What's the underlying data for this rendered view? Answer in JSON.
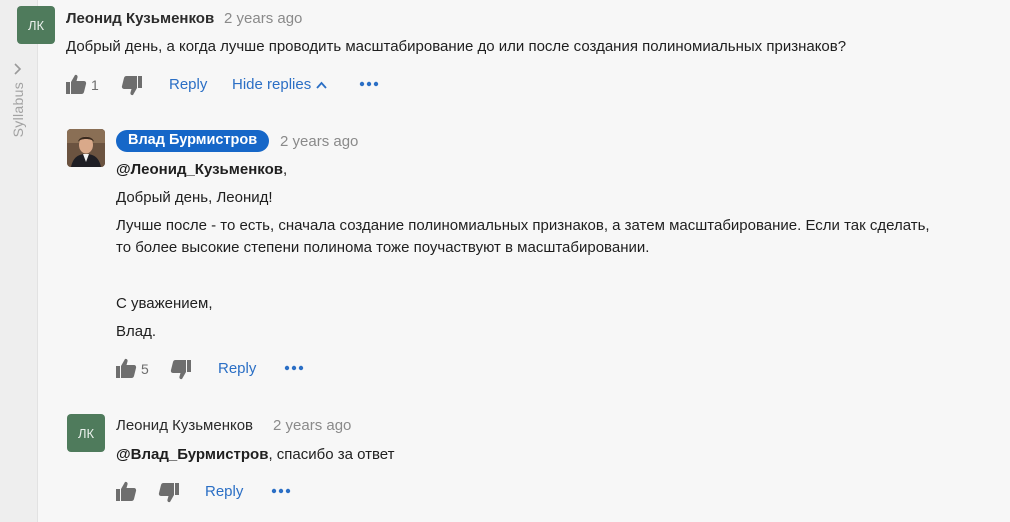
{
  "sidebar": {
    "label": "Syllabus"
  },
  "comment1": {
    "avatar_initials": "ЛК",
    "author": "Леонид Кузьменков",
    "time": "2 years ago",
    "text": "Добрый день, а когда лучше проводить масштабирование до или после создания полиномиальных признаков?",
    "likes": "1",
    "reply_label": "Reply",
    "hide_replies_label": "Hide replies"
  },
  "reply1": {
    "author": "Влад Бурмистров",
    "time": "2 years ago",
    "mention": "@Леонид_Кузьменков",
    "mention_suffix": ",",
    "greeting": "Добрый день, Леонид!",
    "body_line1": "Лучше после - то есть, сначала создание полиномиальных признаков, а затем масштабирование. Если так сделать,",
    "body_line2": "то более высокие степени полинома тоже поучаствуют в масштабировании.",
    "sign_line1": "С уважением,",
    "sign_line2": "Влад.",
    "likes": "5",
    "reply_label": "Reply"
  },
  "reply2": {
    "avatar_initials": "ЛК",
    "author": "Леонид Кузьменков",
    "time": "2 years ago",
    "mention": "@Влад_Бурмистров",
    "text_suffix": ", спасибо за ответ",
    "reply_label": "Reply"
  },
  "colors": {
    "accent": "#2b6fc5",
    "badge": "#1667c8",
    "avatar": "#4f7b5c"
  },
  "icons": [
    "chevron-right-icon",
    "thumbs-up-icon",
    "thumbs-down-icon",
    "more-dots-icon",
    "chevron-up-icon"
  ]
}
